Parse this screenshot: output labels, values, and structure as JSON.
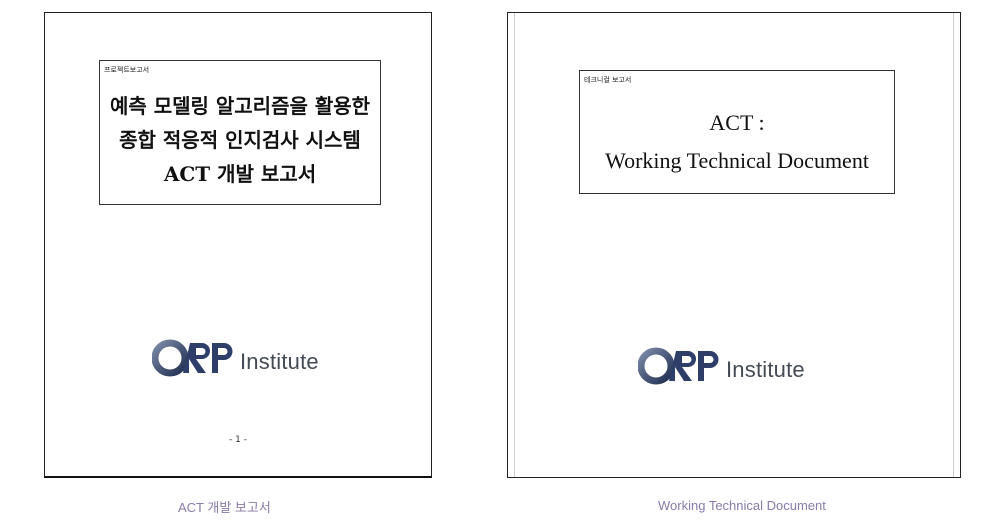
{
  "documents": [
    {
      "tag": "프로젝트보고서",
      "title_lines": [
        "예측 모델링 알고리즘을 활용한",
        "종합 적응적 인지검사 시스템",
        "ACT 개발 보고서"
      ],
      "logo_text": "ORP",
      "logo_suffix": "Institute",
      "page_number": "- 1 -",
      "caption": "ACT 개발 보고서"
    },
    {
      "tag": "테크니컬 보고서",
      "title_lines": [
        "ACT :",
        "Working Technical Document"
      ],
      "logo_text": "ORP",
      "logo_suffix": "Institute",
      "caption": "Working Technical Document"
    }
  ],
  "colors": {
    "logo_O": "#3a4a6a",
    "logo_RP": "#2e3e68",
    "caption": "#8a7ba8",
    "institute": "#444b55"
  }
}
